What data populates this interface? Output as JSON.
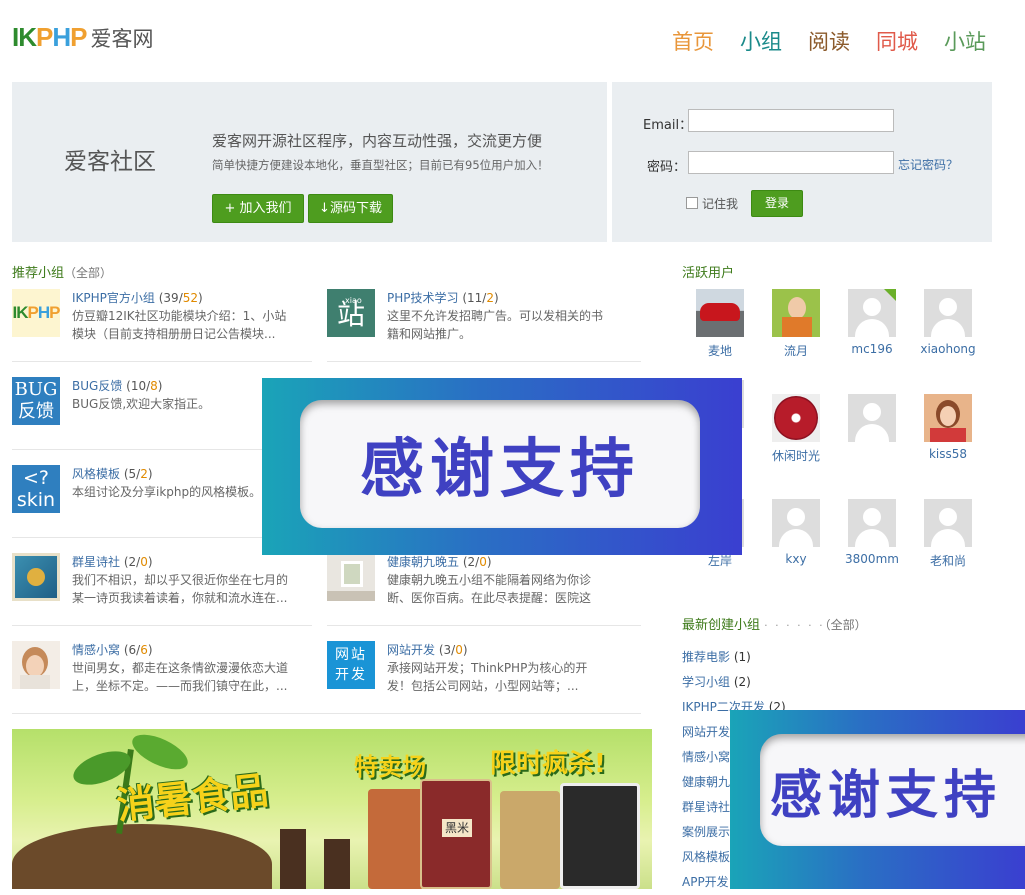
{
  "logo": {
    "letters": [
      "I",
      "K",
      "P",
      "H",
      "P"
    ],
    "letter_colors": [
      "#2e8b2e",
      "#2e8b2e",
      "#f0a030",
      "#3aa0dc",
      "#f0a030"
    ],
    "cn": "爱客网"
  },
  "nav": [
    {
      "label": "首页",
      "color": "#e8963a"
    },
    {
      "label": "小组",
      "color": "#1a8a8a"
    },
    {
      "label": "阅读",
      "color": "#8b5a2b"
    },
    {
      "label": "同城",
      "color": "#e05a4a"
    },
    {
      "label": "小站",
      "color": "#5a9a5a"
    }
  ],
  "hero": {
    "title": "爱客社区",
    "slogan": "爱客网开源社区程序，内容互动性强，交流更方便",
    "desc": "简单快捷方便建设本地化，垂直型社区；目前已有95位用户加入！",
    "join": "+ 加入我们",
    "download": "↓源码下载"
  },
  "login": {
    "email_label": "Email：",
    "password_label": "密码：",
    "forgot": "忘记密码？",
    "remember": "记住我",
    "submit": "登录"
  },
  "groups_section": {
    "title": "推荐小组",
    "more": "（全部）"
  },
  "groups": [
    {
      "name": "IKPHP官方小组",
      "count": "39",
      "extra": "52",
      "desc": "仿豆瓣12IK社区功能模块介绍：1、小站模块（目前支持相册册日记公告模块...",
      "icon": "ikphp-logo-icon"
    },
    {
      "name": "PHP技术学习",
      "count": "11",
      "extra": "2",
      "desc": "这里不允许发招聘广告。可以发相关的书籍和网站推广。",
      "icon": "zhan-icon"
    },
    {
      "name": "BUG反馈",
      "count": "10",
      "extra": "8",
      "desc": "BUG反馈,欢迎大家指正。",
      "icon": "bug-feedback-icon"
    },
    {
      "name": "",
      "count": "",
      "extra": "",
      "desc": "",
      "icon": "hidden-group-icon"
    },
    {
      "name": "风格模板",
      "count": "5",
      "extra": "2",
      "desc": "本组讨论及分享ikphp的风格模板。",
      "icon": "skin-icon"
    },
    {
      "name": "",
      "count": "",
      "extra": "",
      "desc": "",
      "icon": "hidden-group-icon"
    },
    {
      "name": "群星诗社",
      "count": "2",
      "extra": "0",
      "desc": "我们不相识，却以乎又很近你坐在七月的某一诗页我读着读着，你就和流水连在...",
      "icon": "poetry-book-icon"
    },
    {
      "name": "健康朝九晚五",
      "count": "2",
      "extra": "0",
      "desc": "健康朝九晚五小组不能隔着网络为你诊断、医你百病。在此尽表提醒：医院这个...",
      "icon": "window-room-icon"
    },
    {
      "name": "情感小窝",
      "count": "6",
      "extra": "6",
      "desc": "世间男女，都走在这条情欲漫漫依恋大道上，坐标不定。——而我们镇守在此，...",
      "icon": "headphone-girl-icon"
    },
    {
      "name": "网站开发",
      "count": "3",
      "extra": "0",
      "desc": "承接网站开发；ThinkPHP为核心的开发！包括公司网站，小型网站等；...",
      "icon": "web-dev-icon"
    }
  ],
  "active_users": {
    "title": "活跃用户",
    "users": [
      {
        "name": "麦地",
        "avatar": "red-car-avatar"
      },
      {
        "name": "流月",
        "avatar": "girl-flowers-avatar"
      },
      {
        "name": "mc196",
        "avatar": "default-avatar"
      },
      {
        "name": "xiaohong",
        "avatar": "default-avatar"
      },
      {
        "name": "",
        "avatar": "hidden"
      },
      {
        "name": "休闲时光",
        "avatar": "cd-avatar"
      },
      {
        "name": "",
        "avatar": "default-avatar"
      },
      {
        "name": "kiss58",
        "avatar": "girl-avatar"
      },
      {
        "name": "左岸",
        "avatar": "hidden"
      },
      {
        "name": "kxy",
        "avatar": "default-avatar"
      },
      {
        "name": "3800mm",
        "avatar": "default-avatar"
      },
      {
        "name": "老和尚",
        "avatar": "default-avatar"
      }
    ]
  },
  "new_groups": {
    "title": "最新创建小组",
    "dots": "· · · · · ·",
    "more": "（全部）",
    "items": [
      {
        "name": "推荐电影",
        "count": "(1)"
      },
      {
        "name": "学习小组",
        "count": "(2)"
      },
      {
        "name": "IKPHP二次开发",
        "count": "(2)"
      },
      {
        "name": "网站开发",
        "count": ""
      },
      {
        "name": "情感小窝",
        "count": ""
      },
      {
        "name": "健康朝九",
        "count": ""
      },
      {
        "name": "群星诗社",
        "count": ""
      },
      {
        "name": "案例展示",
        "count": ""
      },
      {
        "name": "风格模板",
        "count": ""
      },
      {
        "name": "APP开发",
        "count": ""
      }
    ]
  },
  "overlay": {
    "text": "感谢支持",
    "text_partial": "感谢支持"
  },
  "banner": {
    "title": "消暑食品",
    "sub": "特卖场",
    "slogan": "限时疯杀!",
    "rice_label": "黑米"
  }
}
